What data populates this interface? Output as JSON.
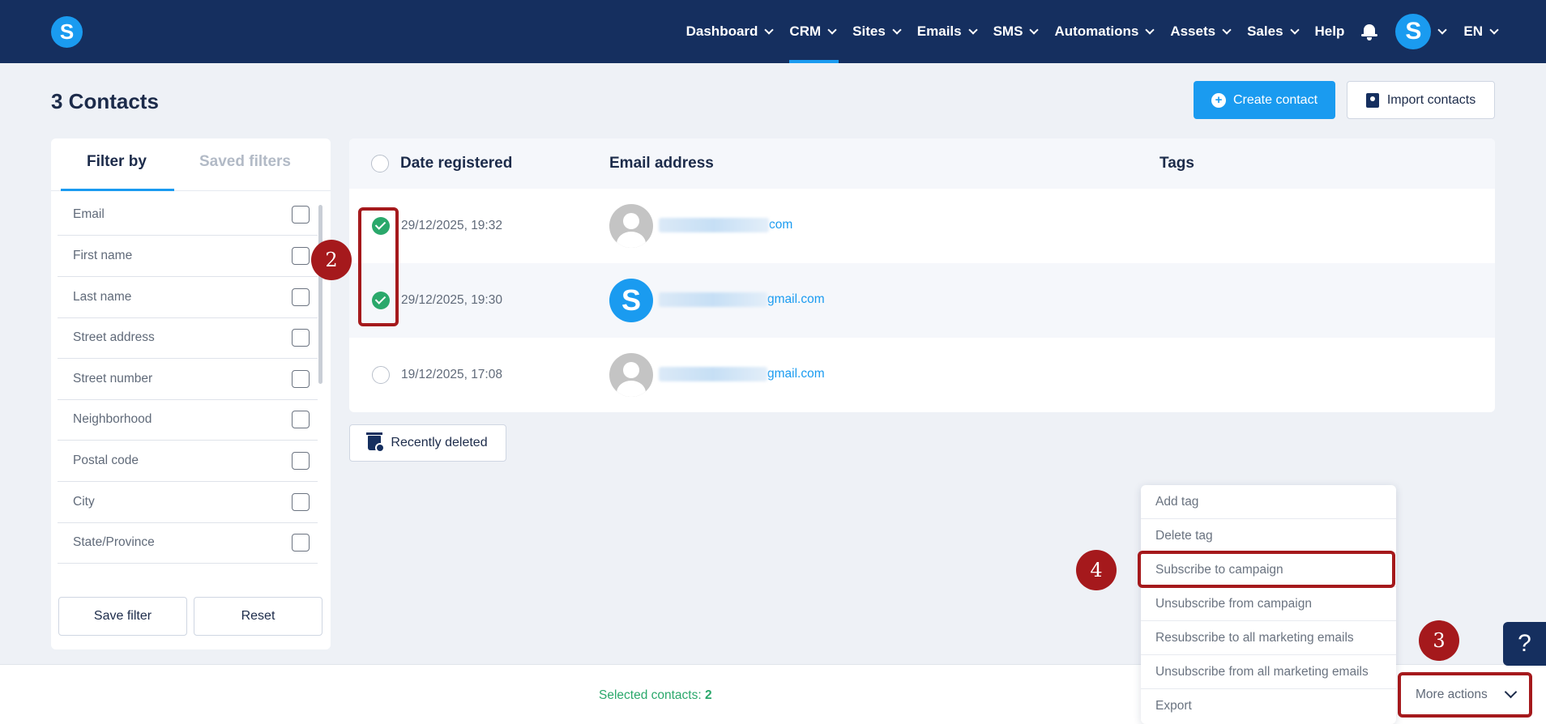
{
  "nav": {
    "logo_letter": "S",
    "items": [
      {
        "label": "Dashboard",
        "has_chevron": true
      },
      {
        "label": "CRM",
        "has_chevron": true,
        "active": true
      },
      {
        "label": "Sites",
        "has_chevron": true
      },
      {
        "label": "Emails",
        "has_chevron": true
      },
      {
        "label": "SMS",
        "has_chevron": true
      },
      {
        "label": "Automations",
        "has_chevron": true
      },
      {
        "label": "Assets",
        "has_chevron": true
      },
      {
        "label": "Sales",
        "has_chevron": true
      },
      {
        "label": "Help",
        "has_chevron": false
      }
    ],
    "avatar_letter": "S",
    "language": "EN"
  },
  "page": {
    "title": "3 Contacts",
    "create_button": "Create contact",
    "import_button": "Import contacts"
  },
  "filters": {
    "tab_active": "Filter by",
    "tab_inactive": "Saved filters",
    "fields": [
      "Email",
      "First name",
      "Last name",
      "Street address",
      "Street number",
      "Neighborhood",
      "Postal code",
      "City",
      "State/Province"
    ],
    "save_button": "Save filter",
    "reset_button": "Reset"
  },
  "table": {
    "headers": {
      "date": "Date registered",
      "email": "Email address",
      "tags": "Tags"
    },
    "rows": [
      {
        "date": "29/12/2025, 19:32",
        "email_visible": "com",
        "selected": true,
        "avatar": "default"
      },
      {
        "date": "29/12/2025, 19:30",
        "email_visible": "gmail.com",
        "selected": true,
        "avatar": "brand",
        "avatar_letter": "S"
      },
      {
        "date": "19/12/2025, 17:08",
        "email_visible": "gmail.com",
        "selected": false,
        "avatar": "default"
      }
    ]
  },
  "recently_deleted": "Recently deleted",
  "menu": {
    "items": [
      "Add tag",
      "Delete tag",
      "Subscribe to campaign",
      "Unsubscribe from campaign",
      "Resubscribe to all marketing emails",
      "Unsubscribe from all marketing emails",
      "Export"
    ]
  },
  "footer": {
    "selected_label": "Selected contacts:",
    "selected_count": "2",
    "more_actions": "More actions",
    "help": "?"
  },
  "annotations": [
    "2",
    "3",
    "4"
  ],
  "colors": {
    "nav_bg": "#152f5f",
    "accent": "#1a9bf0",
    "success": "#2aa86b",
    "annotation": "#a5191c"
  }
}
